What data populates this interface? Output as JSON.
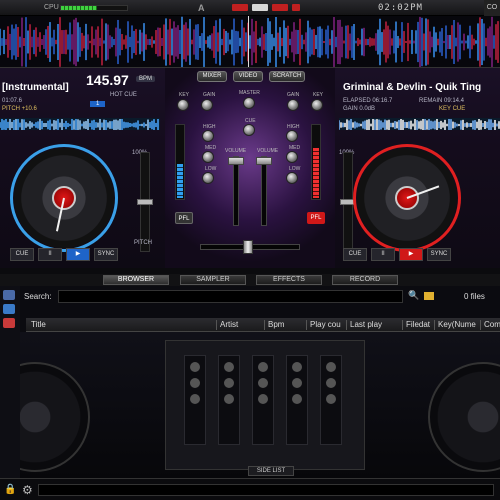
{
  "topbar": {
    "cpu_label": "CPU",
    "cpu_level": 0.55,
    "mode_letter": "A",
    "clock": "02:02PM",
    "config_label": "CO"
  },
  "deck_left": {
    "title": "[Instrumental]",
    "bpm": "145.97",
    "bpm_tag": "BPM",
    "elapsed": "01:07.6",
    "pitch": "PITCH +10.6",
    "hot_cue": "HOT CUE",
    "hot_cue_num": "1",
    "keylock_pct": "100%",
    "pitch_label": "PITCH",
    "buttons": [
      "CUE",
      "II",
      "▶",
      "SYNC"
    ]
  },
  "deck_right": {
    "title": "Griminal & Devlin - Quik Ting",
    "elapsed": "ELAPSED 06:16.7",
    "remain": "REMAIN 09:14.4",
    "gain": "GAIN 0.0dB",
    "key_cue": "KEY CUE",
    "keylock_pct": "100%",
    "buttons": [
      "CUE",
      "II",
      "▶",
      "SYNC"
    ]
  },
  "mixer": {
    "tabs": [
      "MIXER",
      "VIDEO",
      "SCRATCH"
    ],
    "knob_labels": [
      "KEY",
      "GAIN",
      "MASTER",
      "GAIN",
      "KEY"
    ],
    "eq_labels": [
      "HIGH",
      "MED",
      "LOW"
    ],
    "cue_label": "CUE",
    "volume_label": "VOLUME",
    "pfl_left": "PFL",
    "pfl_right": "PFL"
  },
  "tabs": [
    "BROWSER",
    "SAMPLER",
    "EFFECTS",
    "RECORD"
  ],
  "browser": {
    "search_label": "Search:",
    "search_value": "",
    "files_count": "0 files",
    "columns": [
      "Title",
      "Artist",
      "Bpm",
      "Play cou",
      "Last play",
      "Filedat",
      "Key(Nume",
      "Com"
    ],
    "side_list_label": "SIDE LIST"
  },
  "colors": {
    "left_accent": "#1e64c8",
    "right_accent": "#d01818",
    "cpu_meter": "#3fd33f"
  }
}
